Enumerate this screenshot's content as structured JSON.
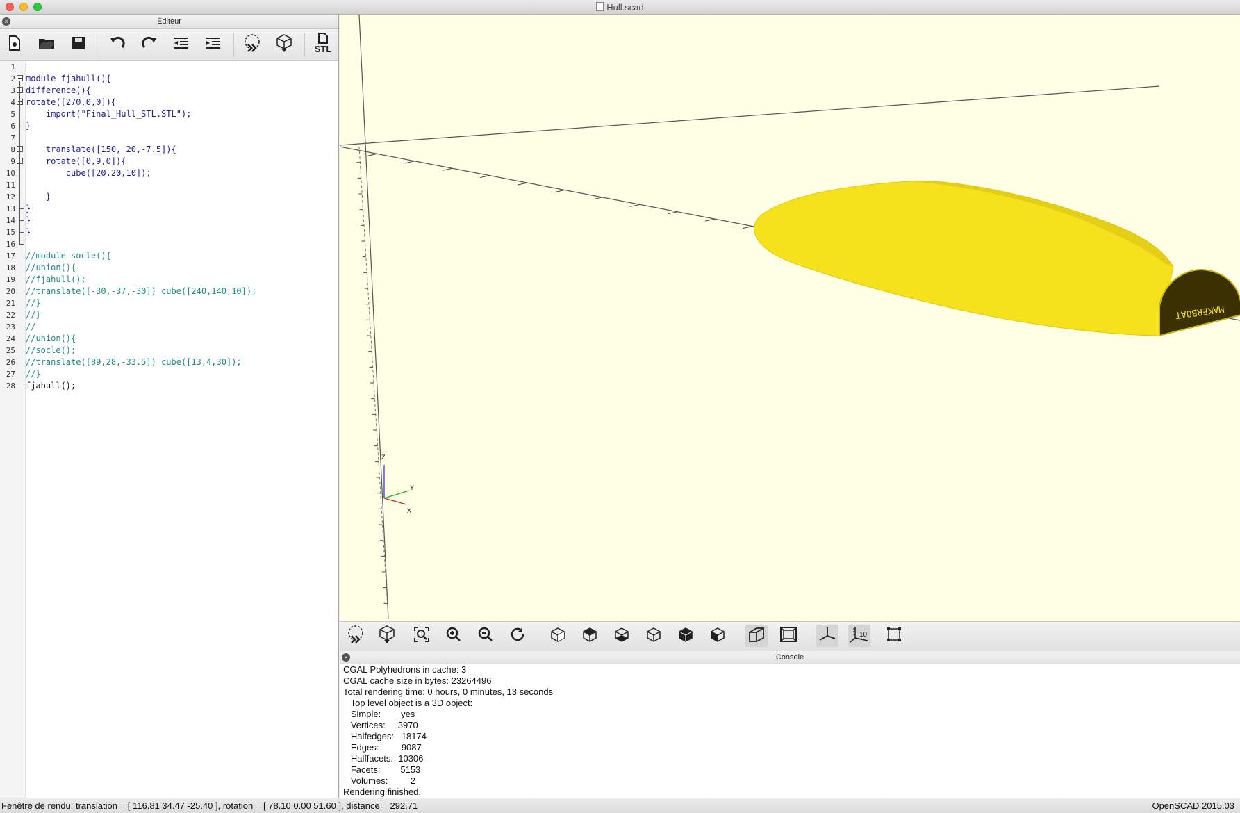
{
  "window": {
    "title": "Hull.scad"
  },
  "editor": {
    "title": "Éditeur",
    "toolbar": [
      {
        "name": "new-file-icon"
      },
      {
        "name": "open-file-icon"
      },
      {
        "name": "save-icon"
      },
      {
        "name": "undo-icon"
      },
      {
        "name": "redo-icon"
      },
      {
        "name": "unindent-icon"
      },
      {
        "name": "indent-icon"
      },
      {
        "name": "preview-icon"
      },
      {
        "name": "render-icon"
      },
      {
        "name": "export-stl-icon",
        "label": "STL"
      }
    ],
    "lines": [
      {
        "n": "1",
        "text": ""
      },
      {
        "n": "2",
        "text": "module fjahull(){"
      },
      {
        "n": "3",
        "text": "difference(){"
      },
      {
        "n": "4",
        "text": "rotate([270,0,0]){"
      },
      {
        "n": "5",
        "text": "    import(\"Final_Hull_STL.STL\");"
      },
      {
        "n": "6",
        "text": "}"
      },
      {
        "n": "7",
        "text": ""
      },
      {
        "n": "8",
        "text": "    translate([150, 20,-7.5]){"
      },
      {
        "n": "9",
        "text": "    rotate([0,9,0]){"
      },
      {
        "n": "10",
        "text": "        cube([20,20,10]);"
      },
      {
        "n": "11",
        "text": ""
      },
      {
        "n": "12",
        "text": "    }"
      },
      {
        "n": "13",
        "text": "}"
      },
      {
        "n": "14",
        "text": "}"
      },
      {
        "n": "15",
        "text": "}"
      },
      {
        "n": "16",
        "text": ""
      },
      {
        "n": "17",
        "text": "//module socle(){"
      },
      {
        "n": "18",
        "text": "//union(){"
      },
      {
        "n": "19",
        "text": "//fjahull();"
      },
      {
        "n": "20",
        "text": "//translate([-30,-37,-30]) cube([240,140,10]);"
      },
      {
        "n": "21",
        "text": "//}"
      },
      {
        "n": "22",
        "text": "//}"
      },
      {
        "n": "23",
        "text": "//"
      },
      {
        "n": "24",
        "text": "//union(){"
      },
      {
        "n": "25",
        "text": "//socle();"
      },
      {
        "n": "26",
        "text": "//translate([89,28,-33.5]) cube([13,4,30]);"
      },
      {
        "n": "27",
        "text": "//}"
      },
      {
        "n": "28",
        "text": "fjahull();"
      }
    ]
  },
  "viewport": {
    "model_text": "MAKERBOAT",
    "axis_labels": {
      "z": "Z",
      "y": "Y",
      "x": "X"
    },
    "colors": {
      "background": "#ffffe5",
      "model": "#f5e21c",
      "model_dark": "#3a3000"
    }
  },
  "view_toolbar": [
    {
      "name": "preview-icon"
    },
    {
      "name": "render-icon"
    },
    {
      "name": "view-all-icon"
    },
    {
      "name": "zoom-in-icon"
    },
    {
      "name": "zoom-out-icon"
    },
    {
      "name": "reset-view-icon"
    },
    {
      "name": "view-right-icon"
    },
    {
      "name": "view-top-icon"
    },
    {
      "name": "view-bottom-icon"
    },
    {
      "name": "view-left-icon"
    },
    {
      "name": "view-front-icon"
    },
    {
      "name": "view-back-icon"
    },
    {
      "name": "perspective-icon"
    },
    {
      "name": "orthogonal-icon"
    },
    {
      "name": "show-axes-icon"
    },
    {
      "name": "show-scale-markers-icon",
      "label": "10"
    },
    {
      "name": "show-edges-icon"
    }
  ],
  "console": {
    "title": "Console",
    "lines": [
      "CGAL Polyhedrons in cache: 3",
      "CGAL cache size in bytes: 23264496",
      "Total rendering time: 0 hours, 0 minutes, 13 seconds",
      "   Top level object is a 3D object:",
      "   Simple:        yes",
      "   Vertices:     3970",
      "   Halfedges:   18174",
      "   Edges:         9087",
      "   Halffacets:  10306",
      "   Facets:        5153",
      "   Volumes:         2",
      "Rendering finished."
    ]
  },
  "statusbar": {
    "left": "Fenêtre de rendu: translation = [ 116.81 34.47 -25.40 ], rotation = [ 78.10 0.00 51.60 ], distance = 292.71",
    "right": "OpenSCAD 2015.03"
  }
}
